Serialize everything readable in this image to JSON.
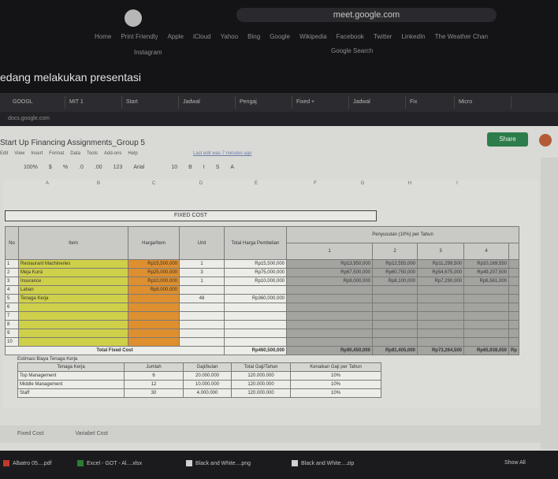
{
  "outer": {
    "url": "meet.google.com",
    "bookmarks": [
      "Home",
      "Print Friendly",
      "Apple",
      "iCloud",
      "Yahoo",
      "Bing",
      "Google",
      "Wikipedia",
      "Facebook",
      "Twitter",
      "LinkedIn",
      "The Weather Chan"
    ],
    "bookmark_instagram": "Instagram",
    "bookmark_google_search": "Google Search",
    "presenting_banner": "edang melakukan presentasi"
  },
  "inner_browser": {
    "tabs": [
      "GOOGL",
      "MIT 1",
      "Start",
      "Jadwal",
      "Pengaj",
      "Fixed +",
      "Jadwal",
      "Fix",
      "Micro"
    ],
    "url": "docs.google.com"
  },
  "sheets": {
    "title": "Start Up Financing Assignments_Group 5",
    "menus": [
      "Edit",
      "View",
      "Insert",
      "Format",
      "Data",
      "Tools",
      "Add-ons",
      "Help"
    ],
    "last_edit": "Last edit was 7 minutes ago",
    "share_label": "Share",
    "toolbar": [
      "100%",
      "$",
      "%",
      ".0",
      ".00",
      "123",
      "Arial",
      "10",
      "B",
      "I",
      "S",
      "A"
    ],
    "column_letters": [
      "A",
      "B",
      "C",
      "D",
      "E",
      "F",
      "G",
      "H",
      "I"
    ]
  },
  "fixed_cost": {
    "title": "FIXED COST",
    "headers": [
      "No",
      "Item",
      "Harga/Item",
      "Unit",
      "Total Harga Pembelian"
    ],
    "depr_header": "Penyusutan (10%) per Tahun",
    "years": [
      "1",
      "2",
      "3",
      "4"
    ],
    "rows": [
      {
        "no": "1",
        "item": "Restaurant Machineries",
        "price": "Rp15,500,000",
        "unit": "1",
        "total": "Rp15,500,000",
        "d": [
          "Rp13,950,000",
          "Rp12,555,000",
          "Rp11,299,500",
          "Rp10,169,550"
        ]
      },
      {
        "no": "2",
        "item": "Meja Kursi",
        "price": "Rp25,000,000",
        "unit": "3",
        "total": "Rp75,000,000",
        "d": [
          "Rp67,500,000",
          "Rp60,750,000",
          "Rp54,675,000",
          "Rp49,207,500"
        ]
      },
      {
        "no": "3",
        "item": "Insurance",
        "price": "Rp10,000,000",
        "unit": "1",
        "total": "Rp10,000,000",
        "d": [
          "Rp9,000,000",
          "Rp8,100,000",
          "Rp7,290,000",
          "Rp6,561,000"
        ]
      },
      {
        "no": "4",
        "item": "Lahan",
        "price": "Rp8,000,000",
        "unit": "",
        "total": "",
        "d": [
          "",
          "",
          "",
          ""
        ]
      },
      {
        "no": "5",
        "item": "Tenaga Kerja",
        "price": "",
        "unit": "48",
        "total": "Rp360,000,000",
        "d": [
          "",
          "",
          "",
          ""
        ]
      },
      {
        "no": "6",
        "item": "",
        "price": "",
        "unit": "",
        "total": "",
        "d": [
          "",
          "",
          "",
          ""
        ]
      },
      {
        "no": "7",
        "item": "",
        "price": "",
        "unit": "",
        "total": "",
        "d": [
          "",
          "",
          "",
          ""
        ]
      },
      {
        "no": "8",
        "item": "",
        "price": "",
        "unit": "",
        "total": "",
        "d": [
          "",
          "",
          "",
          ""
        ]
      },
      {
        "no": "9",
        "item": "",
        "price": "",
        "unit": "",
        "total": "",
        "d": [
          "",
          "",
          "",
          ""
        ]
      },
      {
        "no": "10",
        "item": "",
        "price": "",
        "unit": "",
        "total": "",
        "d": [
          "",
          "",
          "",
          ""
        ]
      }
    ],
    "total_label": "Total Fixed Cost",
    "total_value": "Rp460,500,000",
    "total_years": [
      "Rp90,450,000",
      "Rp81,405,000",
      "Rp73,264,500",
      "Rp65,938,050",
      "Rp"
    ]
  },
  "staff": {
    "title": "Estimasi Biaya Tenaga Kerja",
    "headers": [
      "Tenaga Kerja",
      "Jumlah",
      "Gaji/bulan",
      "Total Gaji/Tahun",
      "Kenaikan Gaji per Tahun"
    ],
    "rows": [
      [
        "Top Management",
        "6",
        "20.000.000",
        "120.000.000",
        "10%"
      ],
      [
        "Middle Management",
        "12",
        "10.000.000",
        "120.000.000",
        "10%"
      ],
      [
        "Staff",
        "30",
        "4.000.000",
        "120.000.000",
        "10%"
      ]
    ]
  },
  "sheet_tabs": [
    "Fixed Cost",
    "Variabel Cost"
  ],
  "downloads": [
    "Albatro 05....pdf",
    "Excel - GOT - Al....xlsx",
    "Black and White....png",
    "Black and White....zip"
  ],
  "show_all": "Show All",
  "colors": {
    "yellow": "#cfd04a",
    "orange": "#de8f2e",
    "share_green": "#2d7d4a"
  }
}
